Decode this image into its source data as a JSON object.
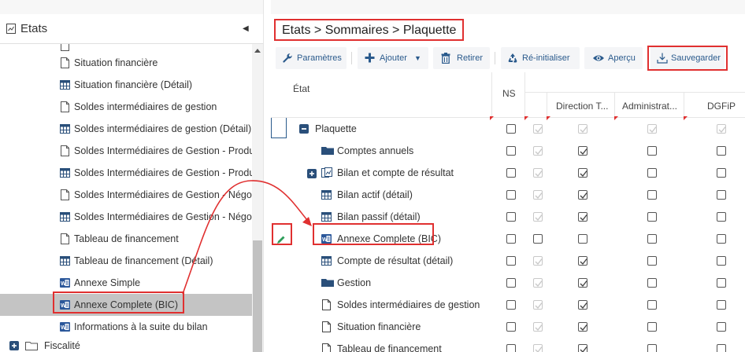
{
  "left_panel": {
    "title": "Etats",
    "items": [
      {
        "label": "Situation financière",
        "icon": "doc-icon"
      },
      {
        "label": "Situation financière (Détail)",
        "icon": "table-icon"
      },
      {
        "label": "Soldes intermédiaires de gestion",
        "icon": "doc-icon"
      },
      {
        "label": "Soldes intermédiaires de gestion (Détail)",
        "icon": "table-icon"
      },
      {
        "label": "Soldes Intermédiaires de Gestion - Producti",
        "icon": "doc-icon"
      },
      {
        "label": "Soldes Intermédiaires de Gestion - Producti",
        "icon": "table-icon"
      },
      {
        "label": "Soldes Intermédiaires de Gestion - Négoce",
        "icon": "doc-icon"
      },
      {
        "label": "Soldes Intermédiaires de Gestion - Négoce (",
        "icon": "table-icon"
      },
      {
        "label": "Tableau de financement",
        "icon": "doc-icon"
      },
      {
        "label": "Tableau de financement (Détail)",
        "icon": "table-icon"
      },
      {
        "label": "Annexe Simple",
        "icon": "word-icon"
      },
      {
        "label": "Annexe Complete (BIC)",
        "icon": "word-icon"
      },
      {
        "label": "Informations à la suite du bilan",
        "icon": "word-icon"
      }
    ],
    "fiscalite": {
      "label": "Fiscalité"
    }
  },
  "breadcrumb": "Etats > Sommaires > Plaquette",
  "toolbar": {
    "parametres": "Paramètres",
    "ajouter": "Ajouter",
    "retirer": "Retirer",
    "reinitialiser": "Ré-initialiser",
    "apercu": "Aperçu",
    "sauvegarder": "Sauvegarder"
  },
  "grid": {
    "headers": {
      "etat": "État",
      "ns": "NS",
      "direction": "Direction T...",
      "administrat": "Administrat...",
      "dgfip": "DGFiP"
    },
    "rows": [
      {
        "label": "Plaquette",
        "icon": "minus-square-icon",
        "cells": [
          false,
          true,
          true,
          true,
          true
        ],
        "ns_enabled": true,
        "state": "dis-checked-all"
      },
      {
        "label": "Comptes annuels",
        "icon": "folder-icon"
      },
      {
        "label": "Bilan et compte de résultat",
        "icon": "chart-doc-icon"
      },
      {
        "label": "Bilan actif (détail)",
        "icon": "table-icon"
      },
      {
        "label": "Bilan passif (détail)",
        "icon": "table-icon"
      },
      {
        "label": "Annexe Complete (BIC)",
        "icon": "word-icon"
      },
      {
        "label": "Compte de résultat (détail)",
        "icon": "table-icon"
      },
      {
        "label": "Gestion",
        "icon": "folder-icon"
      },
      {
        "label": "Soldes intermédiaires de gestion",
        "icon": "doc-icon"
      },
      {
        "label": "Situation financière",
        "icon": "doc-icon"
      },
      {
        "label": "Tableau de financement",
        "icon": "doc-icon"
      }
    ]
  },
  "colors": {
    "accent_blue": "#2a5a8c",
    "highlight_red": "#e03030",
    "edit_green": "#2e9e5b"
  }
}
